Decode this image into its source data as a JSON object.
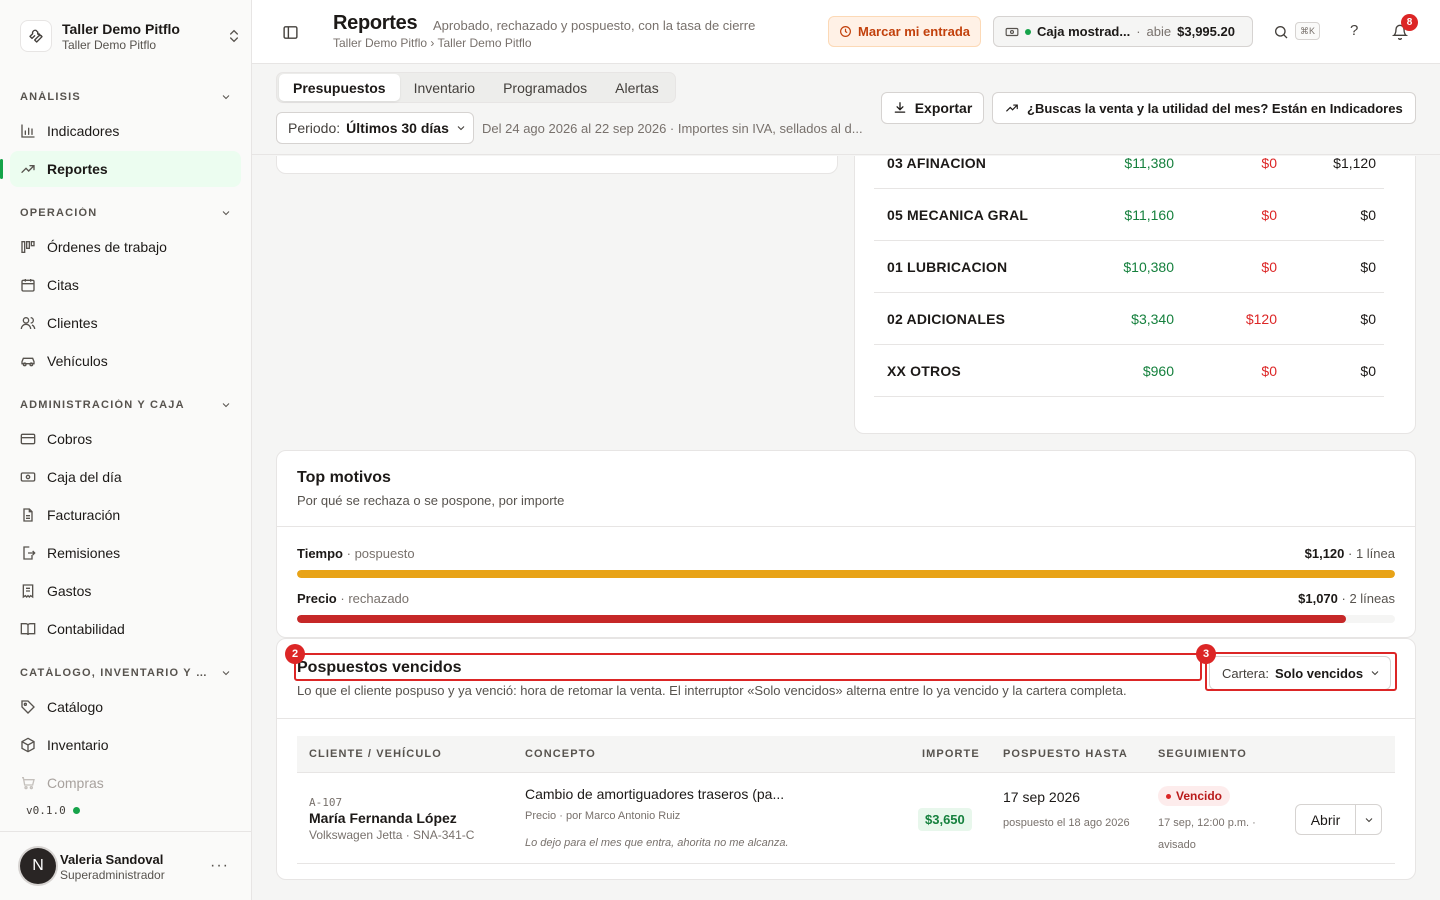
{
  "workspace": {
    "name": "Taller Demo Pitflo",
    "subtitle": "Taller Demo Pitflo"
  },
  "sidebar": {
    "sections": [
      {
        "label": "ANÁLISIS",
        "items": [
          {
            "label": "Indicadores",
            "icon": "bar-chart-icon"
          },
          {
            "label": "Reportes",
            "icon": "trend-icon",
            "active": true
          }
        ]
      },
      {
        "label": "OPERACIÓN",
        "items": [
          {
            "label": "Órdenes de trabajo",
            "icon": "kanban-icon"
          },
          {
            "label": "Citas",
            "icon": "calendar-icon"
          },
          {
            "label": "Clientes",
            "icon": "users-icon"
          },
          {
            "label": "Vehículos",
            "icon": "car-icon"
          }
        ]
      },
      {
        "label": "ADMINISTRACIÓN Y CAJA",
        "items": [
          {
            "label": "Cobros",
            "icon": "card-icon"
          },
          {
            "label": "Caja del día",
            "icon": "cash-icon"
          },
          {
            "label": "Facturación",
            "icon": "file-icon"
          },
          {
            "label": "Remisiones",
            "icon": "file-export-icon"
          },
          {
            "label": "Gastos",
            "icon": "receipt-icon"
          },
          {
            "label": "Contabilidad",
            "icon": "book-icon"
          }
        ]
      },
      {
        "label": "CATÁLOGO, INVENTARIO Y CO...",
        "items": [
          {
            "label": "Catálogo",
            "icon": "tag-icon"
          },
          {
            "label": "Inventario",
            "icon": "box-icon"
          },
          {
            "label": "Compras",
            "icon": "cart-icon"
          }
        ]
      }
    ],
    "version": "v0.1.0",
    "user": {
      "initial": "N",
      "name": "Valeria Sandoval",
      "role": "Superadministrador"
    }
  },
  "header": {
    "title": "Reportes",
    "description": "Aprobado, rechazado y pospuesto, con la tasa de cierre",
    "breadcrumb": "Taller Demo Pitflo › Taller Demo Pitflo",
    "entry_button": "Marcar mi entrada",
    "caja": {
      "name": "Caja mostrad...",
      "status": "abie",
      "amount": "$3,995.20"
    },
    "shortcut": "⌘K",
    "help": "?",
    "notifications": "8"
  },
  "toolbar": {
    "tabs": [
      "Presupuestos",
      "Inventario",
      "Programados",
      "Alertas"
    ],
    "period_label": "Periodo:",
    "period_value": "Últimos 30 días",
    "range_note": "Del 24 ago 2026 al 22 sep 2026 · Importes sin IVA, sellados al d...",
    "export_label": "Exportar",
    "indicators_label": "¿Buscas la venta y la utilidad del mes? Están en Indicadores"
  },
  "categories": [
    {
      "name": "03 AFINACION",
      "approved": "$11,380",
      "rejected": "$0",
      "postponed": "$1,120"
    },
    {
      "name": "05 MECANICA GRAL",
      "approved": "$11,160",
      "rejected": "$0",
      "postponed": "$0"
    },
    {
      "name": "01 LUBRICACION",
      "approved": "$10,380",
      "rejected": "$0",
      "postponed": "$0"
    },
    {
      "name": "02 ADICIONALES",
      "approved": "$3,340",
      "rejected": "$120",
      "postponed": "$0"
    },
    {
      "name": "XX OTROS",
      "approved": "$960",
      "rejected": "$0",
      "postponed": "$0"
    }
  ],
  "motivos": {
    "title": "Top motivos",
    "subtitle": "Por qué se rechaza o se pospone, por importe",
    "rows": [
      {
        "name": "Tiempo",
        "kind": "pospuesto",
        "amount": "$1,120",
        "count": "1 línea",
        "fraction": 1.0,
        "color": "#e8a317"
      },
      {
        "name": "Precio",
        "kind": "rechazado",
        "amount": "$1,070",
        "count": "2 líneas",
        "fraction": 0.955,
        "color": "#c62828"
      }
    ]
  },
  "pospuestos": {
    "title": "Pospuestos vencidos",
    "description": "Lo que el cliente pospuso y ya venció: hora de retomar la venta. El interruptor «Solo vencidos» alterna entre lo ya vencido y la cartera completa.",
    "cartera_label": "Cartera:",
    "cartera_value": "Solo vencidos",
    "marker_title": "2",
    "marker_cartera": "3",
    "columns": [
      "CLIENTE / VEHÍCULO",
      "CONCEPTO",
      "IMPORTE",
      "POSPUESTO HASTA",
      "SEGUIMIENTO"
    ],
    "row": {
      "id": "A-107",
      "client": "María Fernanda López",
      "vehicle": "Volkswagen Jetta · SNA-341-C",
      "concept": "Cambio de amortiguadores traseros (pa...",
      "reason": "Precio",
      "author": "por Marco Antonio Ruiz",
      "note": "Lo dejo para el mes que entra, ahorita no me alcanza.",
      "amount": "$3,650",
      "until": "17 sep 2026",
      "postponed_on": "pospuesto el 18 ago 2026",
      "status": "Vencido",
      "follow_note": "17 sep, 12:00 p.m. · avisado",
      "open_label": "Abrir"
    }
  }
}
